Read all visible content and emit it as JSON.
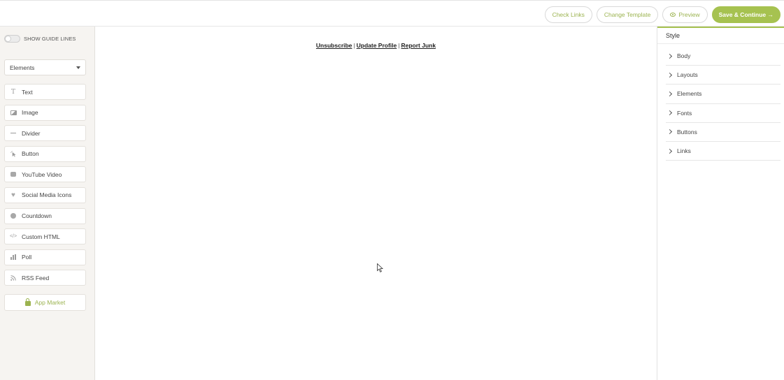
{
  "toolbar": {
    "check_links": "Check Links",
    "change_template": "Change Template",
    "preview": "Preview",
    "save_continue": "Save & Continue →"
  },
  "sidebar": {
    "guide_toggle_label": "SHOW GUIDE LINES",
    "dropdown_value": "Elements",
    "elements": [
      {
        "label": "Text",
        "icon": "text-icon"
      },
      {
        "label": "Image",
        "icon": "image-icon"
      },
      {
        "label": "Divider",
        "icon": "divider-icon"
      },
      {
        "label": "Button",
        "icon": "button-pointer-icon"
      },
      {
        "label": "YouTube Video",
        "icon": "youtube-icon"
      },
      {
        "label": "Social Media Icons",
        "icon": "heart-icon"
      },
      {
        "label": "Countdown",
        "icon": "clock-icon"
      },
      {
        "label": "Custom HTML",
        "icon": "code-icon"
      },
      {
        "label": "Poll",
        "icon": "bar-chart-icon"
      },
      {
        "label": "RSS Feed",
        "icon": "rss-icon"
      }
    ],
    "app_market": "App Market"
  },
  "canvas": {
    "links": [
      "Unsubscribe",
      "Update Profile",
      "Report Junk"
    ],
    "separator": "|"
  },
  "style_panel": {
    "title": "Style",
    "sections": [
      "Body",
      "Layouts",
      "Elements",
      "Fonts",
      "Buttons",
      "Links"
    ]
  },
  "colors": {
    "accent": "#a6c250",
    "accent_text": "#9bb34f",
    "sidebar_bg": "#f6f4f1"
  }
}
